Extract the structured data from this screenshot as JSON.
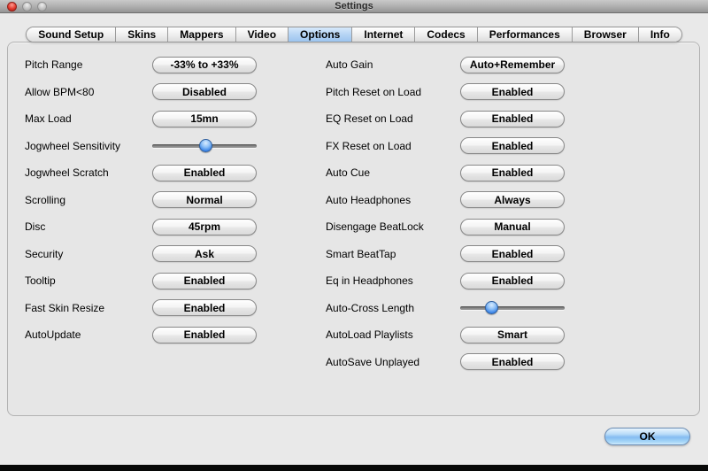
{
  "window": {
    "title": "Settings"
  },
  "tabs": [
    {
      "label": "Sound Setup",
      "selected": false
    },
    {
      "label": "Skins",
      "selected": false
    },
    {
      "label": "Mappers",
      "selected": false
    },
    {
      "label": "Video",
      "selected": false
    },
    {
      "label": "Options",
      "selected": true
    },
    {
      "label": "Internet",
      "selected": false
    },
    {
      "label": "Codecs",
      "selected": false
    },
    {
      "label": "Performances",
      "selected": false
    },
    {
      "label": "Browser",
      "selected": false
    },
    {
      "label": "Info",
      "selected": false
    }
  ],
  "panel": {
    "left_rows": [
      {
        "label": "Pitch Range",
        "type": "button",
        "value": "-33% to +33%"
      },
      {
        "label": "Allow BPM<80",
        "type": "button",
        "value": "Disabled"
      },
      {
        "label": "Max Load",
        "type": "button",
        "value": "15mn"
      },
      {
        "label": "Jogwheel Sensitivity",
        "type": "slider",
        "value_pct": 51,
        "thumb_left": "51%"
      },
      {
        "label": "Jogwheel Scratch",
        "type": "button",
        "value": "Enabled"
      },
      {
        "label": "Scrolling",
        "type": "button",
        "value": "Normal"
      },
      {
        "label": "Disc",
        "type": "button",
        "value": "45rpm"
      },
      {
        "label": "Security",
        "type": "button",
        "value": "Ask"
      },
      {
        "label": "Tooltip",
        "type": "button",
        "value": "Enabled"
      },
      {
        "label": "Fast Skin Resize",
        "type": "button",
        "value": "Enabled"
      },
      {
        "label": "AutoUpdate",
        "type": "button",
        "value": "Enabled"
      }
    ],
    "right_rows": [
      {
        "label": "Auto Gain",
        "type": "button",
        "value": "Auto+Remember"
      },
      {
        "label": "Pitch Reset on Load",
        "type": "button",
        "value": "Enabled"
      },
      {
        "label": "EQ Reset on Load",
        "type": "button",
        "value": "Enabled"
      },
      {
        "label": "FX Reset on Load",
        "type": "button",
        "value": "Enabled"
      },
      {
        "label": "Auto Cue",
        "type": "button",
        "value": "Enabled"
      },
      {
        "label": "Auto Headphones",
        "type": "button",
        "value": "Always"
      },
      {
        "label": "Disengage BeatLock",
        "type": "button",
        "value": "Manual"
      },
      {
        "label": "Smart BeatTap",
        "type": "button",
        "value": "Enabled"
      },
      {
        "label": "Eq in Headphones",
        "type": "button",
        "value": "Enabled"
      },
      {
        "label": "Auto-Cross Length",
        "type": "slider",
        "value_pct": 30,
        "thumb_left": "30%"
      },
      {
        "label": "AutoLoad Playlists",
        "type": "button",
        "value": "Smart"
      },
      {
        "label": "AutoSave Unplayed",
        "type": "button",
        "value": "Enabled"
      }
    ]
  },
  "ok_button": {
    "label": "OK"
  },
  "colors": {
    "selected_tab_blue": "#9cc4ef",
    "slider_thumb_blue": "#3d86e8",
    "ok_button_blue": "#84bcf1",
    "titlebar_gray": "#b3b3b3",
    "close_light_red": "#e33b30"
  }
}
